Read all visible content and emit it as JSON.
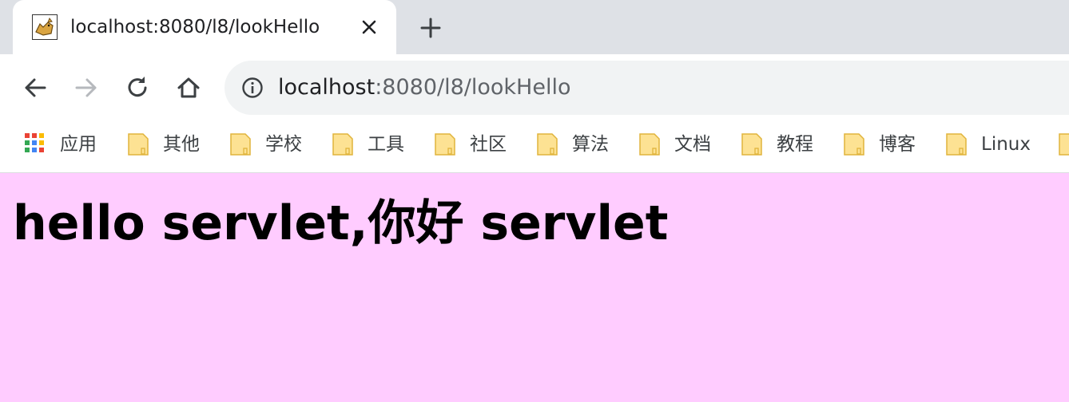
{
  "tab": {
    "title": "localhost:8080/l8/lookHello",
    "favicon": "tomcat-icon"
  },
  "addressbar": {
    "host": "localhost",
    "path": ":8080/l8/lookHello"
  },
  "bookmarks": {
    "apps_label": "应用",
    "items": [
      {
        "label": "其他"
      },
      {
        "label": "学校"
      },
      {
        "label": "工具"
      },
      {
        "label": "社区"
      },
      {
        "label": "算法"
      },
      {
        "label": "文档"
      },
      {
        "label": "教程"
      },
      {
        "label": "博客"
      },
      {
        "label": "Linux"
      }
    ]
  },
  "page": {
    "heading": "hello servlet,你好 servlet",
    "background": "#ffccff"
  },
  "colors": {
    "tabstrip": "#dee1e6",
    "omnibox": "#f1f3f4",
    "folder": "#fde293"
  }
}
